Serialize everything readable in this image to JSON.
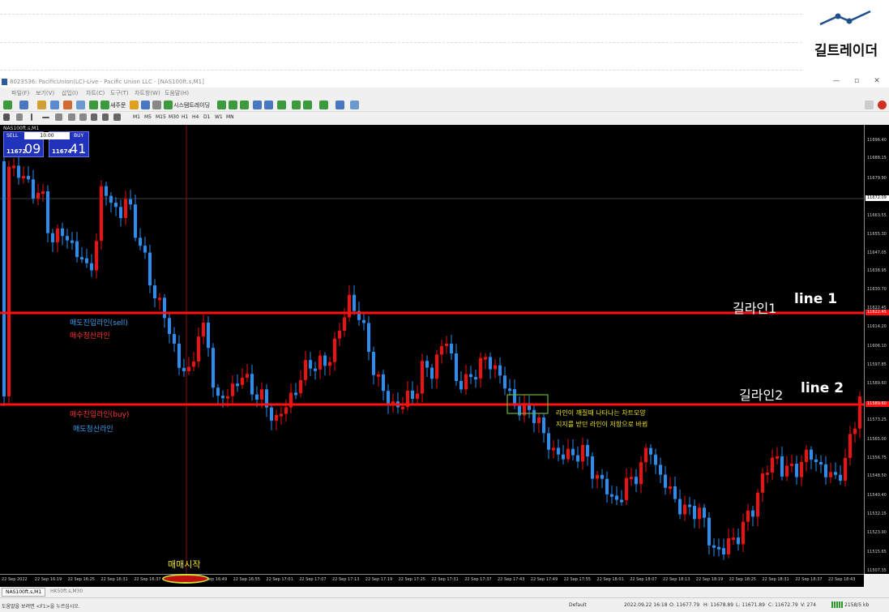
{
  "blog": {
    "logo_text": "길트레이더",
    "logo_color": "#1f4e8c"
  },
  "window": {
    "title": "8023536: PacificUnion(LC)-Live - Pacific Union LLC - [NAS100ft.s,M1]",
    "controls": [
      "—",
      "▫",
      "✕"
    ]
  },
  "menu": [
    "파일(F)",
    "보기(V)",
    "삽입(I)",
    "차트(C)",
    "도구(T)",
    "차트창(W)",
    "도움말(H)"
  ],
  "toolbar": {
    "new_order": "새주문",
    "auto_trading": "시스템트레이딩",
    "timeframes": [
      "M1",
      "M5",
      "M15",
      "M30",
      "H1",
      "H4",
      "D1",
      "W1",
      "MN"
    ]
  },
  "chart": {
    "symbol_label": "NAS100ft.s,M1",
    "colors": {
      "up": "#ee1111",
      "down": "#2a8ef0",
      "background": "#000000",
      "line": "#ff1111"
    },
    "trade_panel": {
      "sell_label": "SELL",
      "buy_label": "BUY",
      "lot": "10.00",
      "sell_price_small": "11672",
      "sell_price_big": "09",
      "buy_price_small": "11674",
      "buy_price_big": "41"
    },
    "price_axis": [
      "11696.40",
      "11688.15",
      "11679.90",
      "11663.55",
      "11655.30",
      "11647.05",
      "11638.95",
      "11630.70",
      "11622.45",
      "11614.20",
      "11606.10",
      "11597.85",
      "11589.60",
      "11573.25",
      "11565.00",
      "11556.75",
      "11548.50",
      "11540.40",
      "11532.15",
      "11523.90",
      "11515.65",
      "11507.35"
    ],
    "price_tags": {
      "current": "11672.09",
      "line1": "11622.45",
      "line2": "11589.60"
    },
    "time_axis": [
      "22 Sep 2022",
      "22 Sep 16:19",
      "22 Sep 16:25",
      "22 Sep 16:31",
      "22 Sep 16:37",
      "22 Sep 16:43",
      "22 Sep 16:49",
      "22 Sep 16:55",
      "22 Sep 17:01",
      "22 Sep 17:07",
      "22 Sep 17:13",
      "22 Sep 17:19",
      "22 Sep 17:25",
      "22 Sep 17:31",
      "22 Sep 17:37",
      "22 Sep 17:43",
      "22 Sep 17:49",
      "22 Sep 17:55",
      "22 Sep 18:01",
      "22 Sep 18:07",
      "22 Sep 18:13",
      "22 Sep 18:19",
      "22 Sep 18:25",
      "22 Sep 18:31",
      "22 Sep 18:37",
      "22 Sep 18:43"
    ],
    "annotations": {
      "sell_entry": "매도진입라인(sell)",
      "buy_exit": "매수청산라인",
      "buy_entry": "매수진입라인(buy)",
      "sell_exit": "매도청산라인",
      "gil_line1": "길라인1",
      "line1": "line 1",
      "gil_line2": "길라인2",
      "line2": "line 2",
      "note1": "라인이 깨질때 나타나는 차트모양",
      "note2": "지지를 받던 라인이 저항으로 바뀜",
      "trade_start": "매매시작"
    }
  },
  "tabs": [
    "NAS100ft.s,M1",
    "HK50ft.s,M30"
  ],
  "status": {
    "help": "도움말을 보려면 <F1>을 누르십시오.",
    "profile": "Default",
    "datetime": "2022.09.22 16:18",
    "open": "O: 11677.79",
    "high": "H: 11678.89",
    "low": "L: 11671.89",
    "close": "C: 11672.79",
    "volume": "V: 274",
    "traffic": "2158/5 kb"
  }
}
